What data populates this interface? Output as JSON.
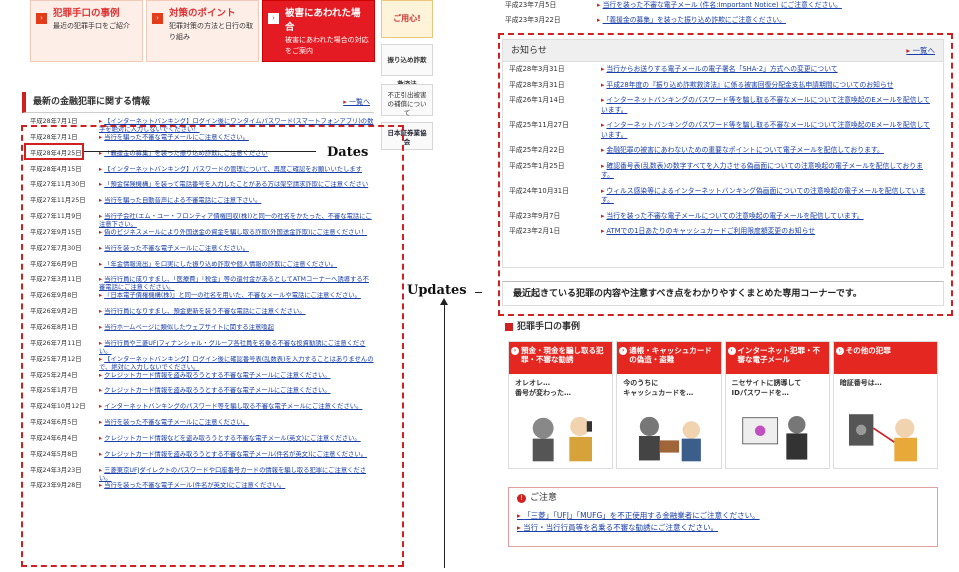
{
  "left_nav": [
    {
      "title": "犯罪手口の事例",
      "sub": "最近の犯罪手口をご紹介"
    },
    {
      "title": "対策のポイント",
      "sub": "犯罪対策の方法と日行の取り組み"
    },
    {
      "title": "被害にあわれた場合",
      "sub": "被害にあわれた場合の対応をご案内"
    }
  ],
  "side_banners": [
    "振り込め詐欺救済法",
    "不正引出被害の補償について",
    "日本証券業協会"
  ],
  "side_top_banner": "ご用心!",
  "news": {
    "heading": "最新の金融犯罪に関する情報",
    "more": "一覧へ",
    "rows": [
      {
        "date": "平成28年7月1日",
        "text": "【インターネットバンキング】ログイン後にワンタイムパスワード(スマートフォンアプリ)の数字を絶対に入力しないでください！"
      },
      {
        "date": "平成28年7月1日",
        "text": "当行を騙った不審な電子メールにご注意ください。"
      },
      {
        "date": "平成28年4月25日",
        "text": "「義援金の募集」を装った振り込め詐欺にご注意ください"
      },
      {
        "date": "平成28年4月15日",
        "text": "【インターネットバンキング】パスワードの管理について、再度ご確認をお願いいたします"
      },
      {
        "date": "平成27年11月30日",
        "text": "「預金保険機構」を装って電話番号を入力したことがある方は架空請求詐欺にご注意ください"
      },
      {
        "date": "平成27年11月25日",
        "text": "当行を騙った自動音声による不審電話にご注意下さい。"
      },
      {
        "date": "平成27年11月9日",
        "text": "当行子会社(エム・ユー・フロンティア債権回収(株))と同一の社名をかたった、不審な電話にご注意下さい。"
      },
      {
        "date": "平成27年9月15日",
        "text": "偽のビジネスメールにより外国送金の資金を騙し取る詐欺(外国送金詐欺)にご注意ください！"
      },
      {
        "date": "平成27年7月30日",
        "text": "当行を装った不審な電子メールにご注意ください。"
      },
      {
        "date": "平成27年6月9日",
        "text": "「年金情報流出」を口実にした振り込め詐欺や個人情報の詐欺にご注意ください。"
      },
      {
        "date": "平成27年3月11日",
        "text": "当行行員に成りすまし、「医療費」「税金」等の還付金があるとしてATMコーナーへ誘導する不審電話にご注意ください。"
      },
      {
        "date": "平成26年9月8日",
        "text": "『日本電子債権機構(株)』と同一の社名を用いた、不審なメールや電話にご注意ください。"
      },
      {
        "date": "平成26年9月2日",
        "text": "当行行員になりすまし、預金更新を装う不審な電話にご注意ください。"
      },
      {
        "date": "平成26年8月1日",
        "text": "当行ホームページに類似したウェブサイトに関する注意喚起"
      },
      {
        "date": "平成26年7月11日",
        "text": "当行行員や三菱UFJフィナンシャル・グループ各社員を名乗る不審な投資勧誘にご注意ください。"
      },
      {
        "date": "平成25年7月12日",
        "text": "【インターネットバンキング】ログイン後に確認番号表(乱数表)を入力することはありませんので、絶対に入力しないでください。"
      },
      {
        "date": "平成25年2月4日",
        "text": "クレジットカード情報を盗み取ろうとする不審な電子メールにご注意ください。"
      },
      {
        "date": "平成25年1月7日",
        "text": "クレジットカード情報を盗み取ろうとする不審な電子メールにご注意ください。"
      },
      {
        "date": "平成24年10月12日",
        "text": "インターネットバンキングのパスワード等を騙し取る不審な電子メールにご注意ください。"
      },
      {
        "date": "平成24年6月5日",
        "text": "当行を装った不審な電子メールにご注意ください。"
      },
      {
        "date": "平成24年6月4日",
        "text": "クレジットカード情報などを盗み取ろうとする不審な電子メール(英文)にご注意ください。"
      },
      {
        "date": "平成24年5月8日",
        "text": "クレジットカード情報を盗み取ろうとする不審な電子メール(件名が英文)にご注意ください。"
      },
      {
        "date": "平成24年3月23日",
        "text": "三菱東京UFJダイレクトのパスワードや口座番号カードの情報を騙し取る犯罪にご注意ください。"
      },
      {
        "date": "平成23年9月28日",
        "text": "当行を装った不審な電子メール(件名が英文)にご注意ください。"
      }
    ]
  },
  "annotations": {
    "dates": "Dates",
    "updates": "Updates"
  },
  "right_top": [
    {
      "date": "平成23年7月5日",
      "text": "当行を装った不審な電子メール (件名:Important Notice) にご注意ください。"
    },
    {
      "date": "平成23年3月22日",
      "text": "「義援金の募集」を装った振り込め詐欺にご注意ください。"
    }
  ],
  "notices": {
    "heading": "お知らせ",
    "more": "一覧へ",
    "rows": [
      {
        "date": "平成28年3月31日",
        "text": "当行からお送りする電子メールの電子署名「SHA-2」方式への変更について"
      },
      {
        "date": "平成28年3月31日",
        "text": "平成28年度の『振り込め詐欺救済法』に係る被害回復分配金支払申請期間についてのお知らせ"
      },
      {
        "date": "平成26年1月14日",
        "text": "インターネットバンキングのパスワード等を騙し取る不審なメールについて注意喚起のEメールを配信しています。"
      },
      {
        "date": "平成25年11月27日",
        "text": "インターネットバンキングのパスワード等を騙し取る不審なメールについて注意喚起のEメールを配信しています。"
      },
      {
        "date": "平成25年2月22日",
        "text": "金融犯罪の被害にあわないための重要なポイントについて電子メールを配信しております。"
      },
      {
        "date": "平成25年1月25日",
        "text": "確認番号表(乱数表)の数字すべてを入力させる偽画面についての注意喚起の電子メールを配信しております。"
      },
      {
        "date": "平成24年10月31日",
        "text": "ウィルス感染等によるインターネットバンキング偽画面についての注意喚起の電子メールを配信しています。"
      },
      {
        "date": "平成23年9月7日",
        "text": "当行を装った不審な電子メールについての注意喚起の電子メールを配信しています。"
      },
      {
        "date": "平成23年2月1日",
        "text": "ATMでの1日あたりのキャッシュカードご利用限度額変更のお知らせ"
      }
    ]
  },
  "focus_banner": "最近起きている犯罪の内容や注意すべき点をわかりやすくまとめた専用コーナーです。",
  "cases": {
    "heading": "犯罪手口の事例",
    "items": [
      {
        "title": "預金・現金を騙し取る犯罪・不審な勧誘",
        "speech": "オレオレ…\n番号が変わった…"
      },
      {
        "title": "通帳・キャッシュカードの偽造・盗難",
        "speech": "今のうちに\nキャッシュカードを…"
      },
      {
        "title": "インターネット犯罪・不審な電子メール",
        "speech": "ニセサイトに誘導して\nIDパスワードを…"
      },
      {
        "title": "その他の犯罪",
        "speech": "暗証番号は…"
      }
    ]
  },
  "caution": {
    "heading": "ご注意",
    "items": [
      "「三菱」「UFJ」「MUFG」を不正使用する金融業者にご注意ください。",
      "当行・当行行員等を名乗る不審な勧誘にご注意ください。"
    ]
  }
}
